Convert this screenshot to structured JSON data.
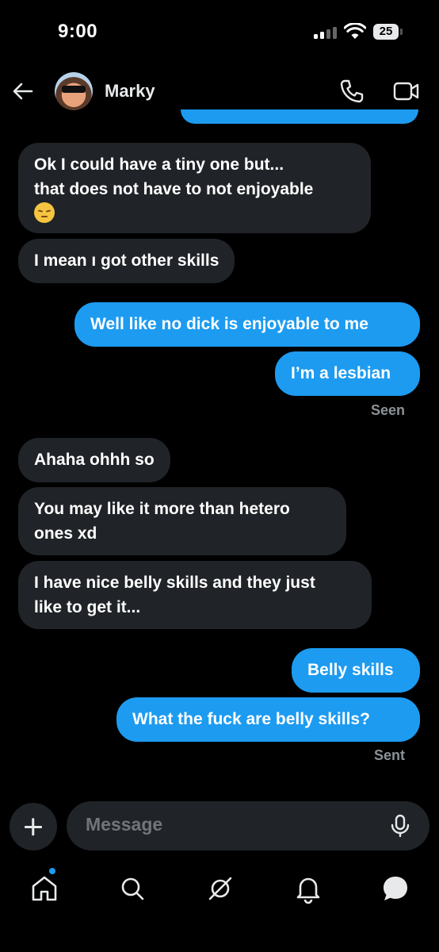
{
  "status_bar": {
    "time": "9:00",
    "battery": "25"
  },
  "header": {
    "contact_name": "Marky",
    "icons": [
      "back-arrow-icon",
      "phone-icon",
      "video-icon"
    ]
  },
  "messages": [
    {
      "side": "received",
      "text_lines": [
        "Ok I could have a tiny one but...",
        "that does not have to not enjoyable"
      ],
      "emoji": "pensive-face-emoji"
    },
    {
      "side": "received",
      "text": "I mean ı got other skills"
    },
    {
      "side": "sent",
      "text": "Well like no dick is enjoyable to me"
    },
    {
      "side": "sent",
      "text": "I’m a lesbian",
      "receipt": "Seen"
    },
    {
      "side": "received",
      "text": "Ahaha ohhh so"
    },
    {
      "side": "received",
      "text_lines": [
        "You may like it more than hetero",
        "ones xd"
      ]
    },
    {
      "side": "received",
      "text_lines": [
        "I have nice belly skills and they just",
        "like to get it..."
      ]
    },
    {
      "side": "sent",
      "text": "Belly skills"
    },
    {
      "side": "sent",
      "text": "What the fuck are belly skills?",
      "receipt": "Sent"
    }
  ],
  "composer": {
    "placeholder": "Message"
  },
  "bottom_nav": {
    "items": [
      "home-icon",
      "search-icon",
      "grok-icon",
      "notifications-icon",
      "messages-icon"
    ],
    "active": "messages-icon",
    "accent": "#1d9bf0"
  },
  "colors": {
    "background": "#000000",
    "sent_bubble": "#1d9bf0",
    "received_bubble": "#202327",
    "receipt_text": "#8b9297"
  }
}
